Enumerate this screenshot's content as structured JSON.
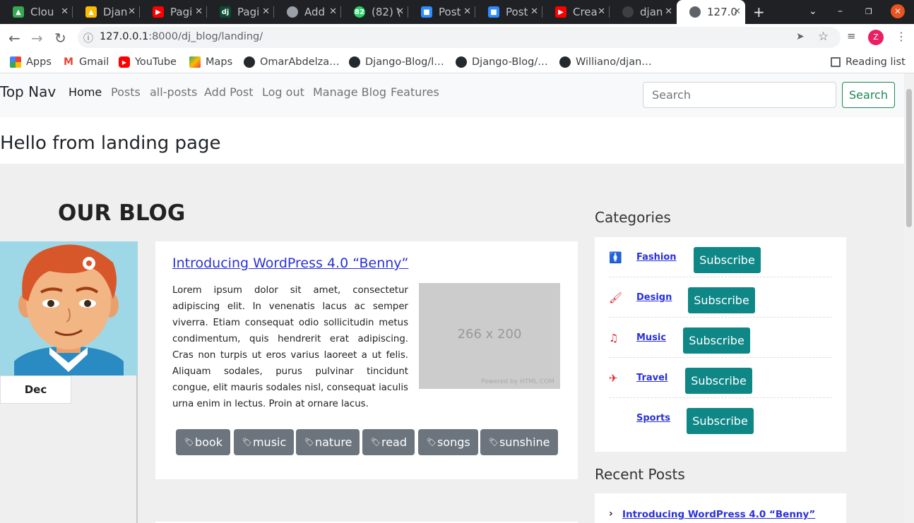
{
  "browser": {
    "tabs": [
      {
        "title": "Clou",
        "icon": "google-drive-icon",
        "color": "#34a853"
      },
      {
        "title": "Djan",
        "icon": "google-drive-icon",
        "color": "#fbbc04"
      },
      {
        "title": "Pagi",
        "icon": "youtube-icon",
        "color": "#ff0000"
      },
      {
        "title": "Pagi",
        "icon": "django-icon",
        "color": "#0c4b33"
      },
      {
        "title": "Add",
        "icon": "globe-icon",
        "color": "#9aa0a6"
      },
      {
        "title": "(82) \\",
        "icon": "whatsapp-icon",
        "color": "#25d366"
      },
      {
        "title": "Post",
        "icon": "zoom-icon",
        "color": "#2d8cff"
      },
      {
        "title": "Post",
        "icon": "zoom-icon",
        "color": "#2d8cff"
      },
      {
        "title": "Crea",
        "icon": "youtube-icon",
        "color": "#ff0000"
      },
      {
        "title": "djan",
        "icon": "github-icon",
        "color": "#24292e"
      },
      {
        "title": "127.0",
        "icon": "globe-icon",
        "color": "#5f6368",
        "active": true
      }
    ],
    "url_host": "127.0.0.1",
    "url_rest": ":8000/dj_blog/landing/",
    "profile_initial": "Z",
    "bookmarks": [
      {
        "label": "Apps",
        "icon": "apps-grid-icon"
      },
      {
        "label": "Gmail",
        "icon": "gmail-icon"
      },
      {
        "label": "YouTube",
        "icon": "youtube-icon"
      },
      {
        "label": "Maps",
        "icon": "maps-icon"
      },
      {
        "label": "OmarAbdelza…",
        "icon": "github-icon"
      },
      {
        "label": "Django-Blog/l…",
        "icon": "github-icon"
      },
      {
        "label": "Django-Blog/…",
        "icon": "github-icon"
      },
      {
        "label": "Williano/djan…",
        "icon": "github-icon"
      }
    ],
    "reading_list": "Reading list"
  },
  "topnav": {
    "brand": "Top Nav",
    "links": [
      "Home",
      "Posts",
      "all-posts",
      "Add Post",
      "Log out",
      "Manage Blog",
      "Features"
    ],
    "search_placeholder": "Search",
    "search_button": "Search"
  },
  "hello": "Hello from landing page",
  "blog": {
    "title": "OUR BLOG",
    "date": "Dec",
    "post": {
      "title": "Introducing WordPress 4.0 “Benny”",
      "body": "Lorem ipsum dolor sit amet, consectetur adipiscing elit. In venenatis lacus ac semper viverra. Etiam consequat odio sollicitudin metus condimentum, quis hendrerit erat adipiscing. Cras non turpis ut eros varius laoreet a ut felis. Aliquam sodales, purus pulvinar tincidunt congue, elit mauris sodales nisl, consequat iaculis urna enim in lectus. Proin at ornare lacus.",
      "image_label": "266 x 200",
      "image_credit": "Powered by HTML.COM",
      "tags": [
        "book",
        "music",
        "nature",
        "read",
        "songs",
        "sunshine"
      ]
    }
  },
  "sidebar": {
    "categories_title": "Categories",
    "categories": [
      {
        "name": "Fashion",
        "icon": "person-icon"
      },
      {
        "name": "Design",
        "icon": "paintbrush-icon"
      },
      {
        "name": "Music",
        "icon": "music-note-icon"
      },
      {
        "name": "Travel",
        "icon": "plane-icon"
      },
      {
        "name": "Sports",
        "icon": ""
      }
    ],
    "subscribe_label": "Subscribe",
    "recent_title": "Recent Posts",
    "recent": [
      "Introducing WordPress 4.0 “Benny”"
    ]
  },
  "colors": {
    "accent_teal": "#0f8787",
    "link_blue": "#2a31d9",
    "tag_grey": "#6c757d",
    "category_red": "#d9232e"
  }
}
